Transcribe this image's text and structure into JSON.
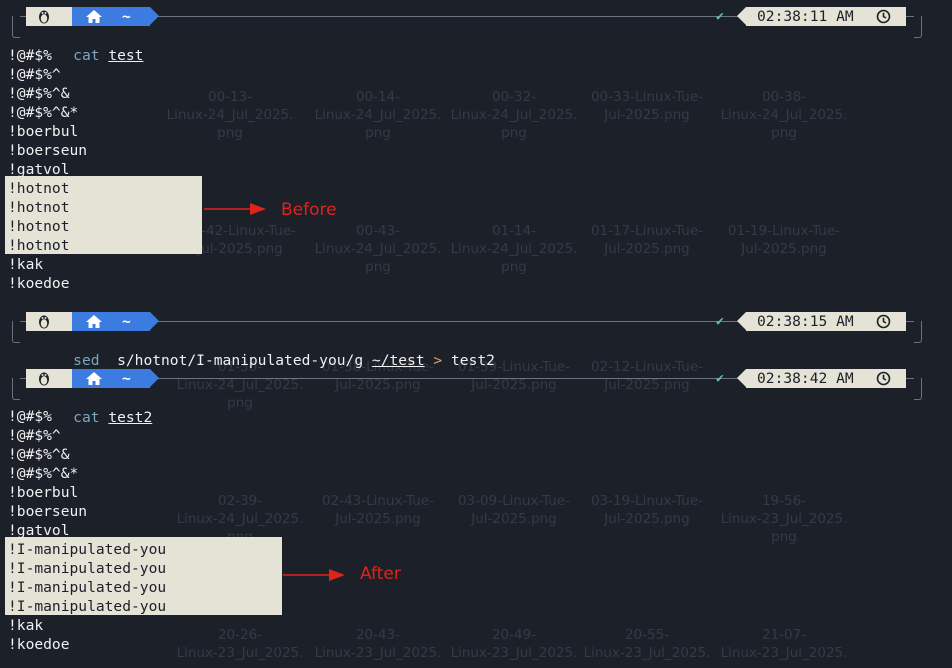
{
  "background_grid": [
    "00-13-\nLinux-24_Jul_2025.\npng",
    "00-14-\nLinux-24_Jul_2025.\npng",
    "00-32-\nLinux-24_Jul_2025.\npng",
    "00-33-Linux-Tue-\nJul-2025.png",
    "00-38-\nLinux-24_Jul_2025.\npng",
    "00-42-Linux-Tue-\nJul-2025.png",
    "00-43-\nLinux-24_Jul_2025.\npng",
    "01-14-\nLinux-24_Jul_2025.\npng",
    "01-17-Linux-Tue-\nJul-2025.png",
    "01-19-Linux-Tue-\nJul-2025.png",
    "01-30-\nLinux-24_Jul_2025.\npng",
    "01-38-Linux-Tue-\nJul-2025.png",
    "01-39-Linux-Tue-\nJul-2025.png",
    "02-12-Linux-Tue-\nJul-2025.png",
    "02-39-\nLinux-24_Jul_2025.\npng",
    "02-39-\nLinux-24_Jul_2025.\npng",
    "02-43-Linux-Tue-\nJul-2025.png",
    "03-09-Linux-Tue-\nJul-2025.png",
    "03-19-Linux-Tue-\nJul-2025.png",
    "19-56-\nLinux-23_Jul_2025.\npng",
    "20-26-\nLinux-23_Jul_2025.",
    "20-43-\nLinux-23_Jul_2025.",
    "20-49-\nLinux-23_Jul_2025.",
    "20-55-\nLinux-23_Jul_2025.",
    "21-07-\nLinux-23_Jul_2025."
  ],
  "prompts": [
    {
      "home": "~",
      "time": "02:38:11 AM",
      "status": "✔"
    },
    {
      "home": "~",
      "time": "02:38:15 AM",
      "status": "✔"
    },
    {
      "home": "~",
      "time": "02:38:42 AM",
      "status": "✔"
    }
  ],
  "commands": [
    {
      "cmd": "cat",
      "arg": "test"
    },
    {
      "cmd": "sed",
      "expr": "s/hotnot/I-manipulated-you/g",
      "path": "~/test",
      "op": ">",
      "out": "test2"
    },
    {
      "cmd": "cat",
      "arg": "test2"
    }
  ],
  "output_before": [
    "!@#$%",
    "!@#$%^",
    "!@#$%^&",
    "!@#$%^&*",
    "!boerbul",
    "!boerseun",
    "!gatvol",
    "!hotnot",
    "!hotnot",
    "!hotnot",
    "!hotnot",
    "!kak",
    "!koedoe"
  ],
  "output_after": [
    "!@#$%",
    "!@#$%^",
    "!@#$%^&",
    "!@#$%^&*",
    "!boerbul",
    "!boerseun",
    "!gatvol",
    "!I-manipulated-you",
    "!I-manipulated-you",
    "!I-manipulated-you",
    "!I-manipulated-you",
    "!kak",
    "!koedoe"
  ],
  "annotations": {
    "before": "Before",
    "after": "After"
  },
  "colors": {
    "accent_blue": "#3c7be0",
    "annotation_red": "#e0231b",
    "highlight": "#e5e2d6"
  },
  "icons": {
    "os": "tux-icon",
    "home": "home-icon",
    "clock": "clock-icon",
    "status": "check-icon"
  }
}
